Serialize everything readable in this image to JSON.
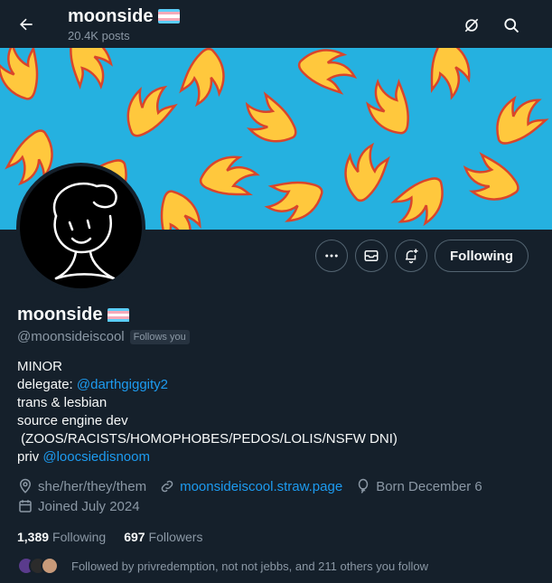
{
  "header": {
    "name": "moonside",
    "posts": "20.4K posts",
    "back_icon": "arrow-left-icon",
    "grok_icon": "grok-icon",
    "search_icon": "search-icon"
  },
  "profile": {
    "display_name": "moonside",
    "handle": "@moonsideiscool",
    "follows_you_badge": "Follows you",
    "flag_colors": [
      "#5bcefa",
      "#f5a9b8",
      "#ffffff",
      "#f5a9b8",
      "#5bcefa"
    ],
    "bio": {
      "line1": "MINOR",
      "line2_prefix": "delegate: ",
      "line2_link": "@darthgiggity2",
      "line3": "trans & lesbian",
      "line4": "source engine dev",
      "line5": " (ZOOS/RACISTS/HOMOPHOBES/PEDOS/LOLIS/NSFW DNI)",
      "line6_prefix": "priv ",
      "line6_link": "@loocsiedisnoom"
    },
    "meta": {
      "pronouns": "she/her/they/them",
      "website": "moonsideiscool.straw.page",
      "birthday": "Born December 6",
      "joined": "Joined July 2024"
    },
    "stats": {
      "following_count": "1,389",
      "following_label": "Following",
      "followers_count": "697",
      "followers_label": "Followers"
    },
    "followed_by": "Followed by privredemption, not not jebbs, and 211 others you follow"
  },
  "actions": {
    "more_icon": "more-icon",
    "message_icon": "message-icon",
    "notify_icon": "bell-plus-icon",
    "following_label": "Following"
  },
  "colors": {
    "background": "#15202b",
    "banner_bg": "#25b1e0",
    "flame_yellow": "#ffc83d",
    "flame_red": "#d9452b",
    "link": "#1d9bf0",
    "muted": "#8b98a5"
  }
}
